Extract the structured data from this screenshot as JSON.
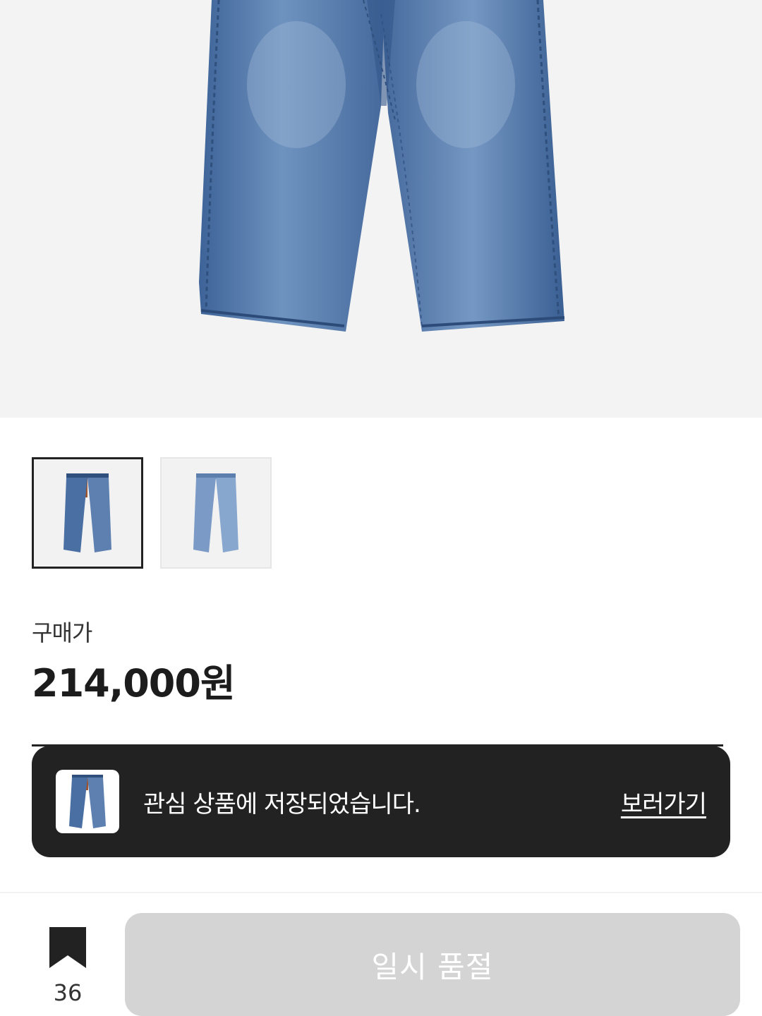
{
  "product": {
    "image_alt": "wide denim jeans",
    "thumbnails": [
      {
        "label": "dark wash jeans",
        "selected": true
      },
      {
        "label": "light wash jeans",
        "selected": false
      }
    ]
  },
  "price": {
    "label": "구매가",
    "value": "214,000원"
  },
  "toast": {
    "message": "관심 상품에 저장되었습니다.",
    "link_label": "보러가기"
  },
  "bottom_bar": {
    "wish_count": "36",
    "soldout_label": "일시 품절"
  },
  "colors": {
    "toast_bg": "#222222",
    "button_disabled": "#d4d4d4",
    "denim": "#4f75a8"
  }
}
